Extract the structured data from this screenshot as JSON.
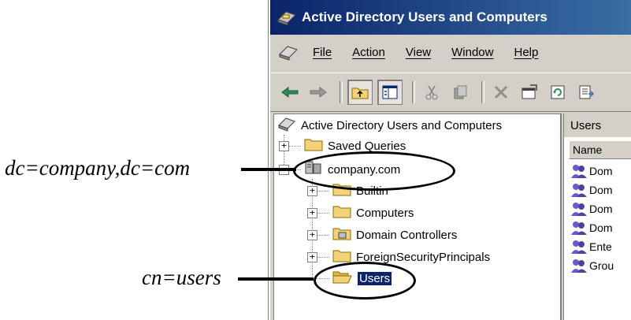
{
  "window": {
    "title": "Active Directory Users and Computers"
  },
  "menu": {
    "items": [
      "File",
      "Action",
      "View",
      "Window",
      "Help"
    ]
  },
  "toolbar": {
    "buttons": [
      "back-arrow",
      "forward-arrow",
      "up-folder",
      "show-hide-tree",
      "cut",
      "copy",
      "delete",
      "properties",
      "refresh",
      "export-list"
    ]
  },
  "tree": {
    "root": "Active Directory Users and Computers",
    "saved_queries": "Saved Queries",
    "domain": "company.com",
    "children": [
      "Builtin",
      "Computers",
      "Domain Controllers",
      "ForeignSecurityPrincipals",
      "Users"
    ]
  },
  "right_pane": {
    "tab": "Users",
    "column_header": "Name",
    "rows": [
      "Dom",
      "Dom",
      "Dom",
      "Dom",
      "Ente",
      "Grou"
    ]
  },
  "annotations": {
    "domain_dn": "dc=company,dc=com",
    "users_cn": "cn=users"
  },
  "colors": {
    "titlebar": "#0a246a",
    "selection": "#0a246a",
    "folder": "#f3d27a"
  }
}
